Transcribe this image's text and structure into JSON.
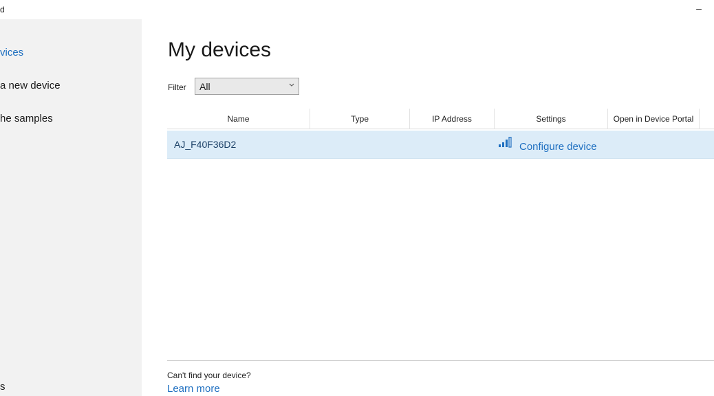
{
  "window": {
    "title": "d",
    "minimize_glyph": "–"
  },
  "sidebar": {
    "items": [
      {
        "label": "vices",
        "active": true
      },
      {
        "label": "a new device",
        "active": false
      },
      {
        "label": "he samples",
        "active": false
      },
      {
        "label": "s",
        "active": false
      }
    ]
  },
  "main": {
    "title": "My devices",
    "filter": {
      "label": "Filter",
      "selected": "All"
    },
    "table": {
      "columns": [
        "Name",
        "Type",
        "IP Address",
        "Settings",
        "Open in Device Portal",
        ""
      ],
      "rows": [
        {
          "name": "AJ_F40F36D2",
          "type": "",
          "ip_address": "",
          "settings": "Configure device",
          "signal_icon": "signal-strength-icon"
        }
      ]
    },
    "footer": {
      "question": "Can't find your device?",
      "link": "Learn more"
    }
  },
  "colors": {
    "accent": "#1e6fc0",
    "sidebar_bg": "#f2f2f2",
    "selected_row_bg": "#dcecf8"
  }
}
